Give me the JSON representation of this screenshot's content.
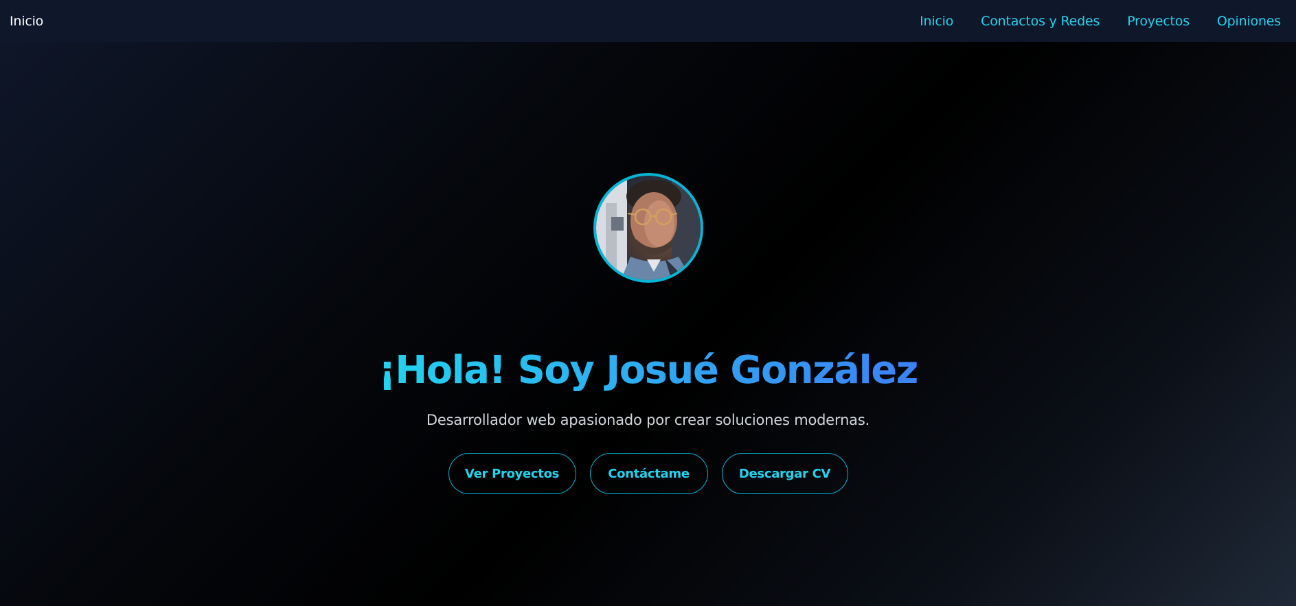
{
  "navbar": {
    "brand": "Inicio",
    "links": [
      {
        "label": "Inicio"
      },
      {
        "label": "Contactos y Redes"
      },
      {
        "label": "Proyectos"
      },
      {
        "label": "Opiniones"
      }
    ]
  },
  "hero": {
    "avatar_icon": "profile-photo",
    "title": "¡Hola! Soy Josué González",
    "subtitle": "Desarrollador web apasionado por crear soluciones modernas.",
    "buttons": [
      {
        "label": "Ver Proyectos"
      },
      {
        "label": "Contáctame"
      },
      {
        "label": "Descargar CV"
      }
    ]
  },
  "colors": {
    "navbar_bg": "#0f172a",
    "accent": "#22d3ee",
    "accent_border": "#06b6d4",
    "title_gradient_start": "#22d3ee",
    "title_gradient_end": "#3b82f6",
    "subtitle": "#d1d5db"
  }
}
